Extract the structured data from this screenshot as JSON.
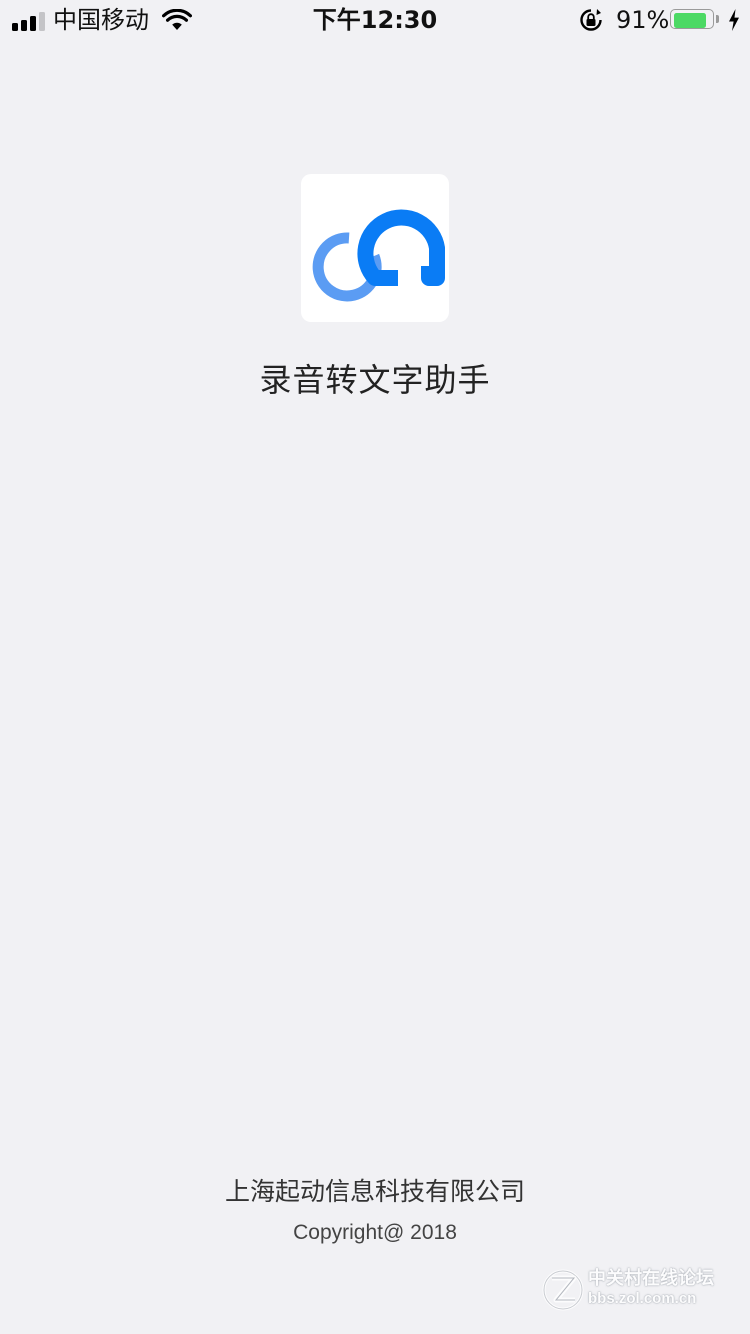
{
  "status_bar": {
    "carrier": "中国移动",
    "time": "下午12:30",
    "battery_percent_label": "91%",
    "battery_level": 0.91,
    "signal_bars_active": 3,
    "signal_bars_total": 4,
    "icons": [
      "signal-icon",
      "wifi-icon",
      "orientation-lock-icon",
      "battery-icon",
      "charging-bolt-icon"
    ]
  },
  "splash": {
    "app_name": "录音转文字助手",
    "logo_icon": "app-logo-icon",
    "colors": {
      "logo_primary": "#0a7cf5",
      "logo_secondary": "#5b9cf3",
      "background": "#f1f1f4"
    }
  },
  "footer": {
    "company": "上海起动信息科技有限公司",
    "copyright": "Copyright@ 2018"
  },
  "watermark": {
    "title": "中关村在线论坛",
    "url": "bbs.zol.com.cn"
  }
}
